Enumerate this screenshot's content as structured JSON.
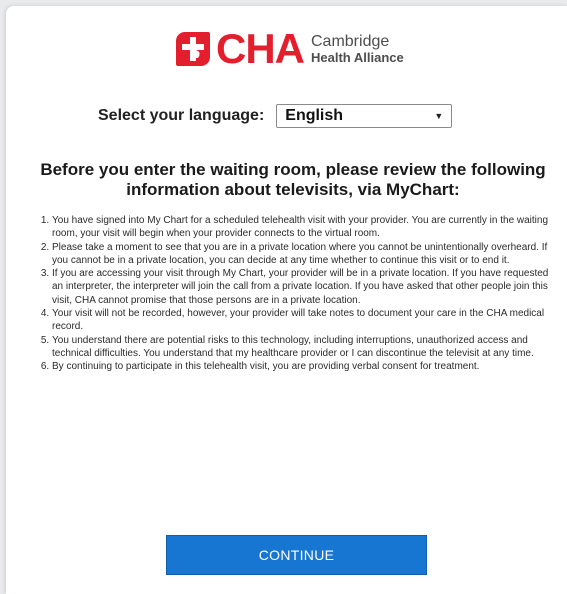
{
  "logo": {
    "wordmark": "CHA",
    "subtitle_line1": "Cambridge",
    "subtitle_line2": "Health Alliance",
    "brand_color": "#e31e2d",
    "icon": "cha-cross-logo-icon"
  },
  "language": {
    "label": "Select your language:",
    "selected": "English",
    "arrow_icon": "triangle-down-icon"
  },
  "heading": "Before you enter the waiting room, please review the following information about televisits, via MyChart:",
  "items": [
    "You have signed into My Chart for a scheduled telehealth visit with your provider. You are currently in the waiting room, your visit will begin when your provider connects to the virtual room.",
    "Please take a moment to see that you are in a private location where you cannot be unintentionally overheard. If you cannot be in a private location, you can decide at any time whether to continue this visit or to end it.",
    "If you are accessing your visit through My Chart, your provider will be in a private location. If you have requested an interpreter, the interpreter will join the call from a private location. If you have asked that other people join this visit, CHA cannot promise that those persons are in a private location.",
    "Your visit will not be recorded, however, your provider will take notes to document your care in the CHA medical record.",
    "You understand there are potential risks to this technology, including interruptions, unauthorized access and technical difficulties. You understand that my healthcare provider or I can discontinue the televisit at any time.",
    "By continuing to participate in this telehealth visit, you are providing verbal consent for treatment."
  ],
  "button": {
    "label": "CONTINUE",
    "color": "#1776d2"
  }
}
